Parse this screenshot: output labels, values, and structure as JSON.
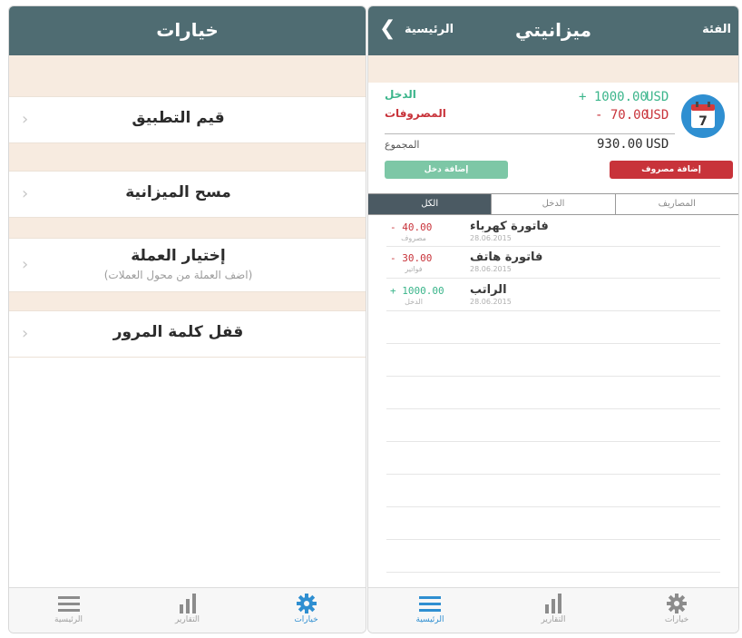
{
  "left_screen": {
    "title": "خيارات",
    "menu": [
      {
        "label": "قيم التطبيق"
      },
      {
        "label": "مسح الميزانية"
      },
      {
        "label": "إختيار العملة",
        "subtitle": "(اضف العملة من محول العملات)"
      },
      {
        "label": "قفل كلمة المرور"
      }
    ],
    "tabs": [
      {
        "label": "الرئيسية",
        "icon": "list-icon"
      },
      {
        "label": "التقارير",
        "icon": "bar-chart-icon"
      },
      {
        "label": "خيارات",
        "icon": "gear-icon"
      }
    ]
  },
  "right_screen": {
    "title": "ميزانيتي",
    "back_label": "الرئيسية",
    "category_label": "الفئة",
    "calendar_day": "7",
    "summary": {
      "income_label": "الدخل",
      "income_amount": "+ 1000.00",
      "income_currency": "USD",
      "expense_label": "المصروفات",
      "expense_amount": "- 70.00",
      "expense_currency": "USD",
      "total_label": "المجموع",
      "total_amount": "930.00",
      "total_currency": "USD"
    },
    "buttons": {
      "add_income": "إضافة دخل",
      "add_expense": "إضافة مصروف"
    },
    "segments": [
      "المصاريف",
      "الدخل",
      "الكل"
    ],
    "transactions": [
      {
        "title": "فاتورة كهرباء",
        "date": "28.06.2015",
        "amount": "- 40.00",
        "category": "مصروف"
      },
      {
        "title": "فاتورة هاتف",
        "date": "28.06.2015",
        "amount": "- 30.00",
        "category": "فواتير"
      },
      {
        "title": "الراتب",
        "date": "28.06.2015",
        "amount": "+ 1000.00",
        "category": "الدخل"
      }
    ],
    "tabs": [
      {
        "label": "الرئيسية",
        "icon": "list-icon"
      },
      {
        "label": "التقارير",
        "icon": "bar-chart-icon"
      },
      {
        "label": "خيارات",
        "icon": "gear-icon"
      }
    ]
  },
  "colors": {
    "nav_bar": "#4f6c72",
    "income": "#3bb58b",
    "expense": "#c8333a",
    "accent_blue": "#2f8fd1",
    "beige": "#f7ebe0"
  }
}
